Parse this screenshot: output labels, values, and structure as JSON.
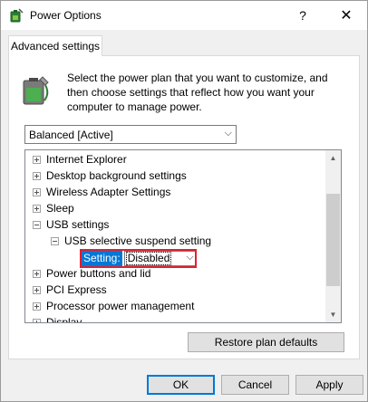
{
  "window": {
    "title": "Power Options",
    "help_label": "?",
    "close_label": "✕"
  },
  "tab": {
    "label": "Advanced settings"
  },
  "description": "Select the power plan that you want to customize, and then choose settings that reflect how you want your computer to manage power.",
  "plan_select": {
    "value": "Balanced [Active]"
  },
  "tree": {
    "items": [
      {
        "label": "Internet Explorer",
        "expander": "plus",
        "indent": 0
      },
      {
        "label": "Desktop background settings",
        "expander": "plus",
        "indent": 0
      },
      {
        "label": "Wireless Adapter Settings",
        "expander": "plus",
        "indent": 0
      },
      {
        "label": "Sleep",
        "expander": "plus",
        "indent": 0
      },
      {
        "label": "USB settings",
        "expander": "minus",
        "indent": 0
      },
      {
        "label": "USB selective suspend setting",
        "expander": "minus",
        "indent": 1
      },
      {
        "label": "",
        "expander": "none",
        "indent": 2
      },
      {
        "label": "Power buttons and lid",
        "expander": "plus",
        "indent": 0
      },
      {
        "label": "PCI Express",
        "expander": "plus",
        "indent": 0
      },
      {
        "label": "Processor power management",
        "expander": "plus",
        "indent": 0
      },
      {
        "label": "Display",
        "expander": "plus",
        "indent": 0
      }
    ],
    "setting": {
      "label": "Setting:",
      "value": "Disabled"
    }
  },
  "buttons": {
    "restore": "Restore plan defaults",
    "ok": "OK",
    "cancel": "Cancel",
    "apply": "Apply"
  },
  "colors": {
    "accent": "#0078d7",
    "highlight": "#e0202d"
  }
}
